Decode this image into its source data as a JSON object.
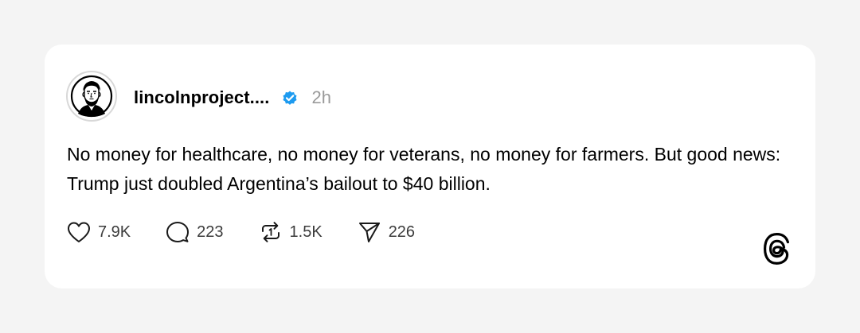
{
  "post": {
    "username": "lincolnproject....",
    "timestamp": "2h",
    "text": "No money for healthcare, no money for veterans, no money for farmers. But good news: Trump just doubled Argentina’s bailout to $40 billion.",
    "verified": true,
    "verified_color": "#1d9bf0"
  },
  "actions": {
    "like": {
      "icon": "heart-icon",
      "count": "7.9K"
    },
    "reply": {
      "icon": "comment-bubble-icon",
      "count": "223"
    },
    "repost": {
      "icon": "repost-arrows-icon",
      "count": "1.5K"
    },
    "share": {
      "icon": "send-plane-icon",
      "count": "226"
    }
  },
  "branding": {
    "logo_icon": "threads-logo-icon"
  }
}
